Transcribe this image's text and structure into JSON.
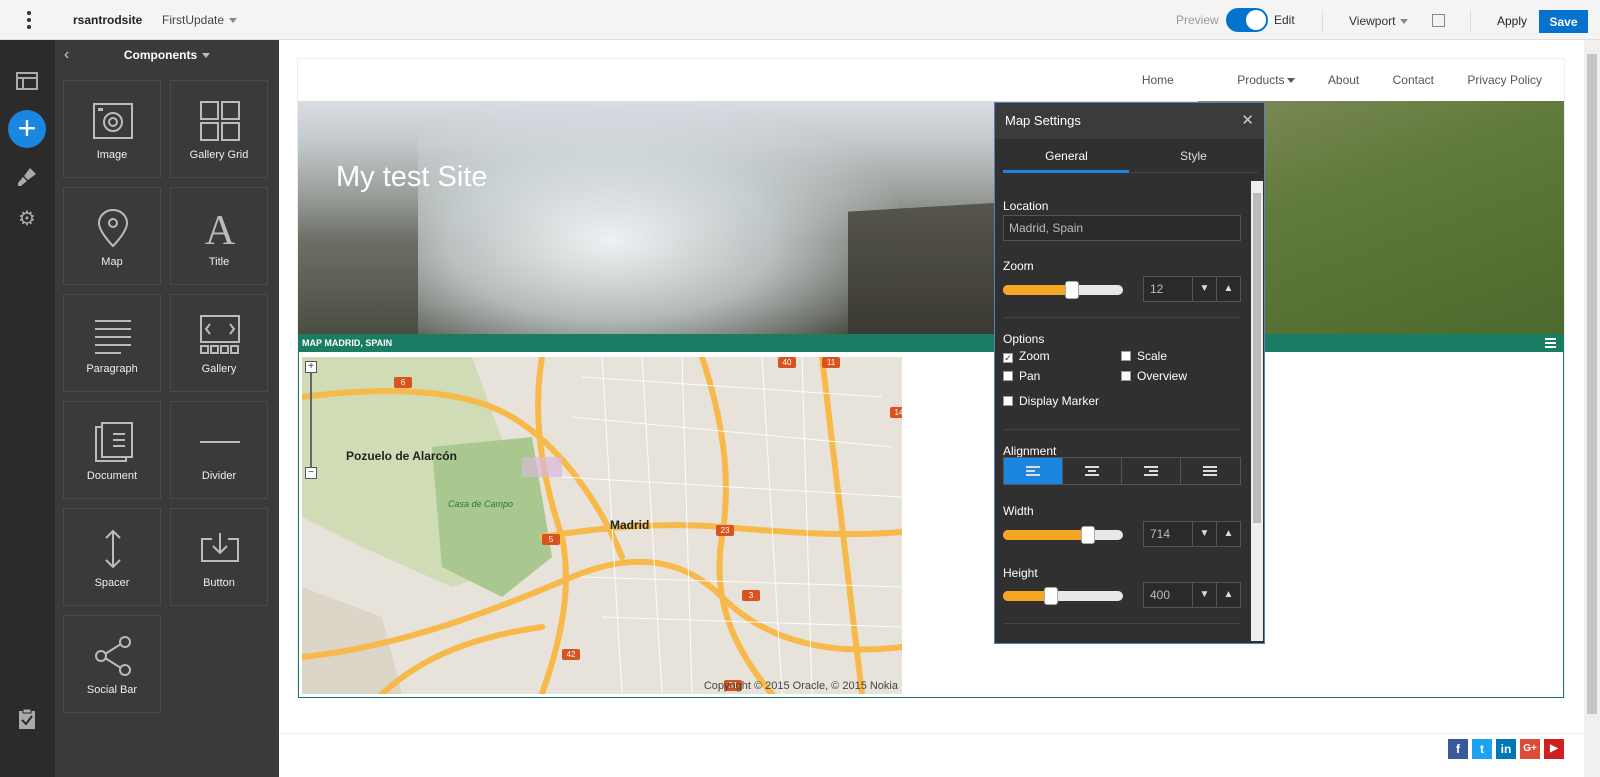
{
  "topbar": {
    "site_name": "rsantrodsite",
    "update_name": "FirstUpdate",
    "preview_label": "Preview",
    "edit_label": "Edit",
    "viewport_label": "Viewport",
    "apply_label": "Apply",
    "save_label": "Save"
  },
  "components": {
    "header": "Components",
    "tiles": [
      {
        "label": "Image",
        "icon": "image-icon"
      },
      {
        "label": "Gallery Grid",
        "icon": "gallery-grid-icon"
      },
      {
        "label": "Map",
        "icon": "map-pin-icon"
      },
      {
        "label": "Title",
        "icon": "title-icon"
      },
      {
        "label": "Paragraph",
        "icon": "paragraph-icon"
      },
      {
        "label": "Gallery",
        "icon": "gallery-icon"
      },
      {
        "label": "Document",
        "icon": "document-icon"
      },
      {
        "label": "Divider",
        "icon": "divider-icon"
      },
      {
        "label": "Spacer",
        "icon": "spacer-icon"
      },
      {
        "label": "Button",
        "icon": "button-icon"
      },
      {
        "label": "Social Bar",
        "icon": "share-icon"
      }
    ]
  },
  "site": {
    "nav": [
      "Home",
      "Products",
      "About",
      "Contact",
      "Privacy Policy"
    ],
    "hero_title": "My test Site",
    "map_bar": "MAP  MADRID, SPAIN",
    "map_labels": {
      "pozuelo": "Pozuelo de Alarcón",
      "madrid": "Madrid",
      "casa": "Casa de Campo",
      "copyright": "Copyright © 2015 Oracle, © 2015 Nokia"
    },
    "shields": [
      "6",
      "40",
      "11",
      "14",
      "5",
      "23",
      "3",
      "42",
      "31"
    ]
  },
  "map_settings": {
    "title": "Map Settings",
    "tabs": [
      "General",
      "Style"
    ],
    "location_label": "Location",
    "location_value": "Madrid, Spain",
    "zoom_label": "Zoom",
    "zoom_value": "12",
    "options_label": "Options",
    "options": {
      "zoom": "Zoom",
      "scale": "Scale",
      "pan": "Pan",
      "overview": "Overview",
      "display_marker": "Display Marker"
    },
    "alignment_label": "Alignment",
    "width_label": "Width",
    "width_value": "714",
    "height_label": "Height",
    "height_value": "400"
  },
  "social": [
    {
      "name": "f",
      "color": "#3b5998"
    },
    {
      "name": "t",
      "color": "#1da1f2"
    },
    {
      "name": "in",
      "color": "#0077b5"
    },
    {
      "name": "G+",
      "color": "#dd4b39"
    },
    {
      "name": "▶",
      "color": "#cd201f"
    }
  ]
}
